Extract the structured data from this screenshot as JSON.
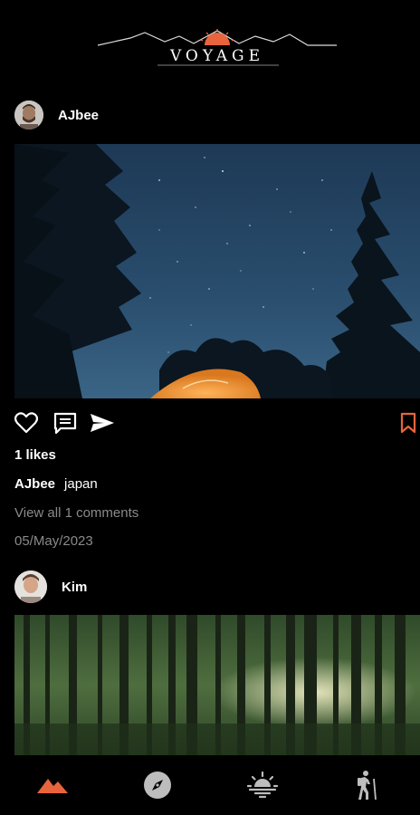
{
  "app": {
    "logo_text": "VOYAGE",
    "accent": "#e8643c"
  },
  "posts": [
    {
      "username": "AJbee",
      "likes": "1 likes",
      "caption_user": "AJbee",
      "caption_text": "japan",
      "view_comments": "View all 1 comments",
      "date": "05/May/2023"
    },
    {
      "username": "Kim"
    }
  ],
  "actions": {
    "icons": [
      "heart-icon",
      "comment-icon",
      "send-icon",
      "bookmark-icon"
    ]
  },
  "bottom_nav": {
    "items": [
      "mountains-icon",
      "compass-icon",
      "sunrise-icon",
      "hiker-icon"
    ],
    "active_index": 0
  }
}
